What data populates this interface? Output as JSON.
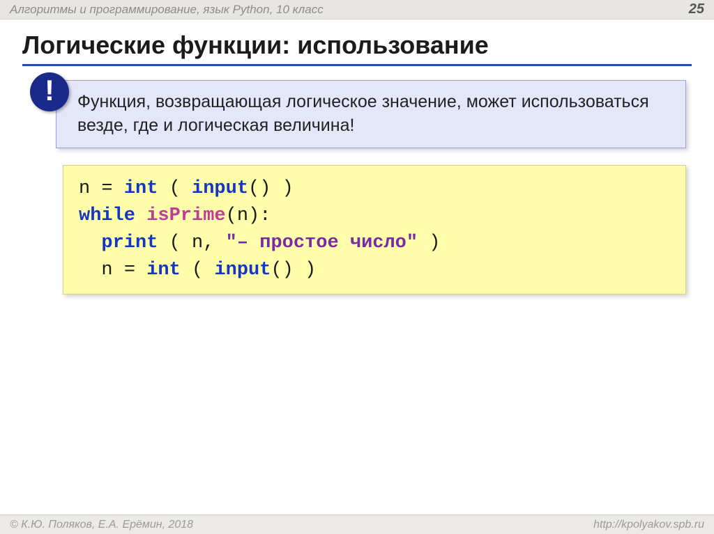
{
  "header": {
    "subject": "Алгоритмы и программирование, язык Python, 10 класс",
    "page_number": "25"
  },
  "title": "Логические функции: использование",
  "note": {
    "badge": "!",
    "text": "Функция, возвращающая логическое значение, может использоваться везде, где и логическая величина!"
  },
  "code": {
    "lines": [
      [
        {
          "t": "n ",
          "c": "plain"
        },
        {
          "t": "=",
          "c": "plain"
        },
        {
          "t": " ",
          "c": "plain"
        },
        {
          "t": "int",
          "c": "kw"
        },
        {
          "t": " ( ",
          "c": "plain"
        },
        {
          "t": "input",
          "c": "kw"
        },
        {
          "t": "() )",
          "c": "plain"
        }
      ],
      [
        {
          "t": "while",
          "c": "kw"
        },
        {
          "t": " ",
          "c": "plain"
        },
        {
          "t": "isPrime",
          "c": "fn"
        },
        {
          "t": "(n):",
          "c": "plain"
        }
      ],
      [
        {
          "t": "  ",
          "c": "plain"
        },
        {
          "t": "print",
          "c": "kw"
        },
        {
          "t": " ( n, ",
          "c": "plain"
        },
        {
          "t": "\"– простое число\"",
          "c": "str"
        },
        {
          "t": " )",
          "c": "plain"
        }
      ],
      [
        {
          "t": "  n ",
          "c": "plain"
        },
        {
          "t": "=",
          "c": "plain"
        },
        {
          "t": " ",
          "c": "plain"
        },
        {
          "t": "int",
          "c": "kw"
        },
        {
          "t": " ( ",
          "c": "plain"
        },
        {
          "t": "input",
          "c": "kw"
        },
        {
          "t": "() )",
          "c": "plain"
        }
      ]
    ]
  },
  "footer": {
    "copyright": "© К.Ю. Поляков, Е.А. Ерёмин, 2018",
    "url": "http://kpolyakov.spb.ru"
  }
}
